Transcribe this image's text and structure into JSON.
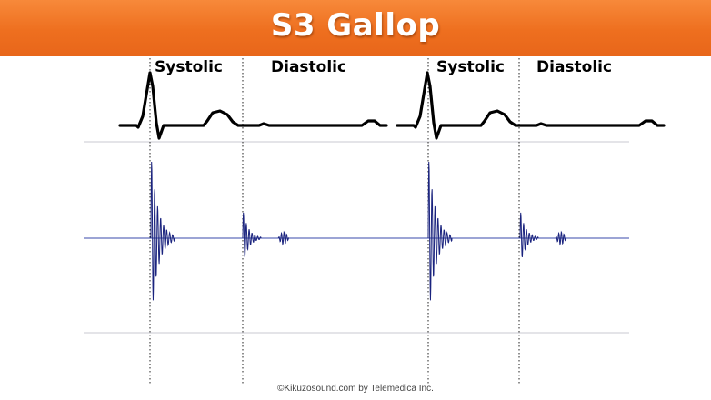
{
  "title": "S3 Gallop",
  "phase_labels": [
    {
      "text": "Systolic"
    },
    {
      "text": "Diastolic"
    },
    {
      "text": "Systolic"
    },
    {
      "text": "Diastolic"
    }
  ],
  "footer": "©Kikuzosound.com by Telemedica Inc.",
  "colors": {
    "title_bar": "#ee6f1f",
    "title_text": "#ffffff",
    "ecg_trace": "#000000",
    "phono_trace": "#1a237e",
    "baseline": "#3949ab",
    "gridline": "#c8c8d0"
  }
}
